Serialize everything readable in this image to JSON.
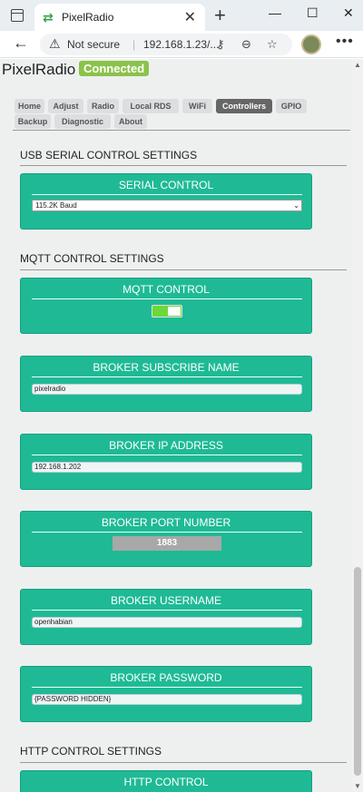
{
  "browser": {
    "tab_title": "PixelRadio",
    "not_secure": "Not secure",
    "url": "192.168.1.23/...",
    "buttons": {
      "new_tab": "+",
      "minimize": "—",
      "maximize": "☐",
      "close": "✕",
      "tab_close": "✕",
      "back": "←",
      "menu": "•••"
    }
  },
  "header": {
    "brand": "PixelRadio",
    "status": "Connected",
    "status_color": "#8bc34a"
  },
  "nav": {
    "tabs": [
      "Home",
      "Adjust",
      "Radio",
      "Local RDS",
      "WiFi",
      "Controllers",
      "GPIO",
      "Backup",
      "Diagnostic",
      "About"
    ],
    "active": "Controllers"
  },
  "sections": {
    "usb": "USB SERIAL CONTROL SETTINGS",
    "mqtt": "MQTT CONTROL SETTINGS",
    "http": "HTTP CONTROL SETTINGS"
  },
  "cards": {
    "serial_control": {
      "title": "SERIAL CONTROL",
      "value": "115.2K Baud"
    },
    "mqtt_control": {
      "title": "MQTT CONTROL",
      "enabled": true
    },
    "broker_subscribe": {
      "title": "BROKER SUBSCRIBE NAME",
      "value": "pixelradio"
    },
    "broker_ip": {
      "title": "BROKER IP ADDRESS",
      "value": "192.168.1.202"
    },
    "broker_port": {
      "title": "BROKER PORT NUMBER",
      "value": "1883"
    },
    "broker_username": {
      "title": "BROKER USERNAME",
      "value": "openhabian"
    },
    "broker_password": {
      "title": "BROKER PASSWORD",
      "value": "{PASSWORD HIDDEN}"
    },
    "http_control": {
      "title": "HTTP CONTROL"
    }
  },
  "colors": {
    "card": "#1fba95",
    "toggle_on": "#6dd83a",
    "active_tab": "#666666"
  }
}
